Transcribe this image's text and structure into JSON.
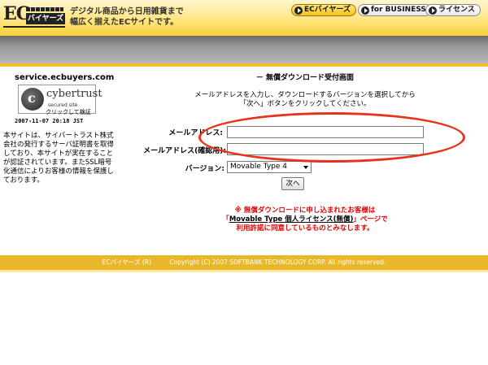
{
  "header": {
    "logo_text": "EC",
    "logo_kana": "バイヤーズ",
    "tagline_lines": [
      "デジタル商品から日用雑貨まで",
      "幅広く揃えたECサイトです。"
    ],
    "nav": [
      {
        "label": "ECバイヤーズ",
        "active": true
      },
      {
        "label": "for BUSINESS",
        "active": false
      },
      {
        "label": "ライセンス",
        "active": false
      }
    ]
  },
  "sidebar": {
    "domain": "service.ecbuyers.com",
    "badge_name": "cybertrust",
    "badge_sub": "secured site",
    "verify_link": "クリックして検証",
    "verify_time": "2007-11-07 20:18 JST",
    "ssl_note": "本サイトは、サイバートラスト株式会社の発行するサーバ証明書を取得しており、本サイトが実在することが認証されています。またSSL暗号化通信によりお客様の情報を保護しております。"
  },
  "form": {
    "title": "－ 無償ダウンロード受付画面",
    "intro_lines": [
      "メールアドレスを入力し、ダウンロードするバージョンを選択してから",
      "「次へ」ボタンをクリックしてください。"
    ],
    "email_label": "メールアドレス",
    "email_value": "",
    "email_confirm_label": "メールアドレス(確認用)",
    "email_confirm_value": "",
    "version_label": "バージョン",
    "version_selected": "Movable Type 4",
    "next_label": "次へ"
  },
  "notice": {
    "line1": "※ 無償ダウンロードに申し込まれたお客様は",
    "line2_pre": "「",
    "product_link": "Movable Type 個人ライセンス(無償)",
    "line2_post": "」ページで",
    "line3": "利用許諾に同意しているものとみなします。"
  },
  "footer": {
    "brand": "ECバイヤーズ (R)",
    "copyright": "Copyright (C) 2007 SOFTBANK TECHNOLOGY CORP. All rights reserved."
  },
  "colors": {
    "header_yellow": "#ffe47a",
    "accent_red": "#e8321c",
    "footer_gold": "#e9b82a"
  }
}
